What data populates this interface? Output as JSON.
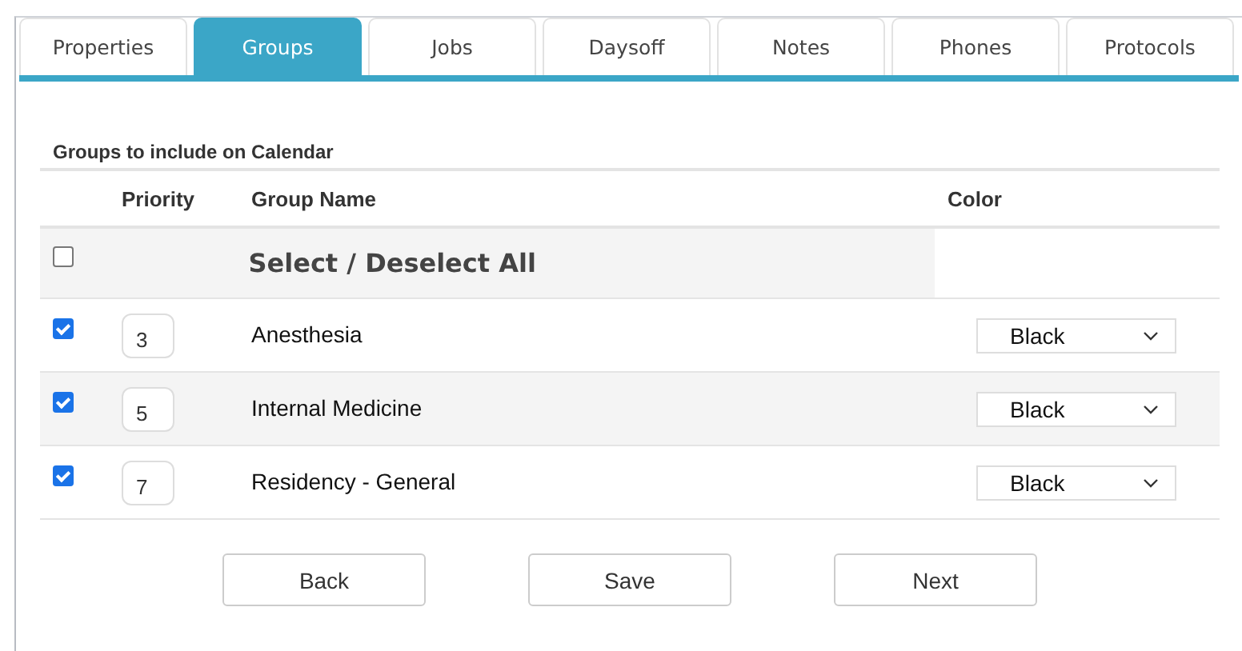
{
  "tabs": [
    {
      "label": "Properties",
      "selected": false
    },
    {
      "label": "Groups",
      "selected": true
    },
    {
      "label": "Jobs",
      "selected": false
    },
    {
      "label": "Daysoff",
      "selected": false
    },
    {
      "label": "Notes",
      "selected": false
    },
    {
      "label": "Phones",
      "selected": false
    },
    {
      "label": "Protocols",
      "selected": false
    }
  ],
  "section_title": "Groups to include on Calendar",
  "table": {
    "columns": [
      "Priority",
      "Group Name",
      "Color"
    ],
    "select_all": {
      "label": "Select / Deselect All",
      "checked": false
    },
    "rows": [
      {
        "checked": true,
        "priority": "3",
        "name": "Anesthesia",
        "color_choice": "Black"
      },
      {
        "checked": true,
        "priority": "5",
        "name": "Internal Medicine",
        "color_choice": "Black"
      },
      {
        "checked": true,
        "priority": "7",
        "name": "Residency - General",
        "color_choice": "Black"
      }
    ]
  },
  "buttons": [
    "Back",
    "Save",
    "Next"
  ]
}
